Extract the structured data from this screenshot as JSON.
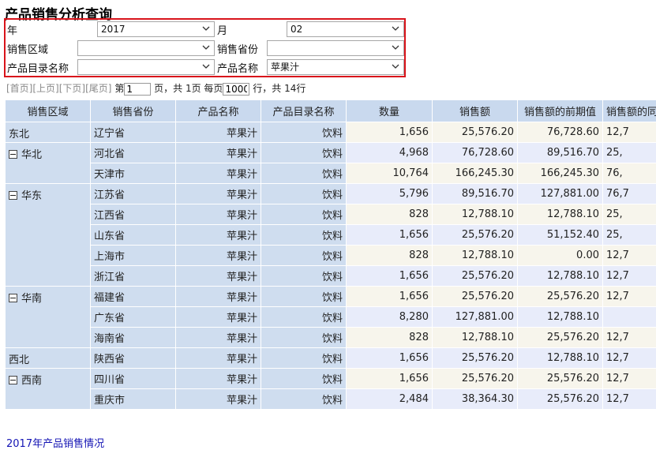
{
  "title": "产品销售分析查询",
  "filters": {
    "year_label": "年",
    "year_value": "2017",
    "month_label": "月",
    "month_value": "02",
    "region_label": "销售区域",
    "region_value": "",
    "province_label": "销售省份",
    "province_value": "",
    "category_label": "产品目录名称",
    "category_value": "",
    "product_label": "产品名称",
    "product_value": "苹果汁"
  },
  "pager": {
    "first": "[首页]",
    "prev": "[上页]",
    "next": "[下页]",
    "last": "[尾页]",
    "page_prefix": "第",
    "page_value": "1",
    "page_suffix": "页，共 1页 每页",
    "per_page_value": "1000",
    "row_suffix": "行，共 14行"
  },
  "table": {
    "headers": [
      "销售区域",
      "销售省份",
      "产品名称",
      "产品目录名称",
      "数量",
      "销售额",
      "销售额的前期值",
      "销售额的同"
    ],
    "groups": [
      {
        "region": "东北",
        "collapsible": false,
        "rows": [
          {
            "province": "辽宁省",
            "product": "苹果汁",
            "category": "饮料",
            "qty": "1,656",
            "sales": "25,576.20",
            "prev": "76,728.60",
            "yoy": "12,7"
          }
        ]
      },
      {
        "region": "华北",
        "collapsible": true,
        "rows": [
          {
            "province": "河北省",
            "product": "苹果汁",
            "category": "饮料",
            "qty": "4,968",
            "sales": "76,728.60",
            "prev": "89,516.70",
            "yoy": "25,"
          },
          {
            "province": "天津市",
            "product": "苹果汁",
            "category": "饮料",
            "qty": "10,764",
            "sales": "166,245.30",
            "prev": "166,245.30",
            "yoy": "76,"
          }
        ]
      },
      {
        "region": "华东",
        "collapsible": true,
        "rows": [
          {
            "province": "江苏省",
            "product": "苹果汁",
            "category": "饮料",
            "qty": "5,796",
            "sales": "89,516.70",
            "prev": "127,881.00",
            "yoy": "76,7"
          },
          {
            "province": "江西省",
            "product": "苹果汁",
            "category": "饮料",
            "qty": "828",
            "sales": "12,788.10",
            "prev": "12,788.10",
            "yoy": "25,"
          },
          {
            "province": "山东省",
            "product": "苹果汁",
            "category": "饮料",
            "qty": "1,656",
            "sales": "25,576.20",
            "prev": "51,152.40",
            "yoy": "25,"
          },
          {
            "province": "上海市",
            "product": "苹果汁",
            "category": "饮料",
            "qty": "828",
            "sales": "12,788.10",
            "prev": "0.00",
            "yoy": "12,7"
          },
          {
            "province": "浙江省",
            "product": "苹果汁",
            "category": "饮料",
            "qty": "1,656",
            "sales": "25,576.20",
            "prev": "12,788.10",
            "yoy": "12,7"
          }
        ]
      },
      {
        "region": "华南",
        "collapsible": true,
        "rows": [
          {
            "province": "福建省",
            "product": "苹果汁",
            "category": "饮料",
            "qty": "1,656",
            "sales": "25,576.20",
            "prev": "25,576.20",
            "yoy": "12,7"
          },
          {
            "province": "广东省",
            "product": "苹果汁",
            "category": "饮料",
            "qty": "8,280",
            "sales": "127,881.00",
            "prev": "12,788.10",
            "yoy": ""
          },
          {
            "province": "海南省",
            "product": "苹果汁",
            "category": "饮料",
            "qty": "828",
            "sales": "12,788.10",
            "prev": "25,576.20",
            "yoy": "12,7"
          }
        ]
      },
      {
        "region": "西北",
        "collapsible": false,
        "rows": [
          {
            "province": "陕西省",
            "product": "苹果汁",
            "category": "饮料",
            "qty": "1,656",
            "sales": "25,576.20",
            "prev": "12,788.10",
            "yoy": "12,7"
          }
        ]
      },
      {
        "region": "西南",
        "collapsible": true,
        "rows": [
          {
            "province": "四川省",
            "product": "苹果汁",
            "category": "饮料",
            "qty": "1,656",
            "sales": "25,576.20",
            "prev": "25,576.20",
            "yoy": "12,7"
          },
          {
            "province": "重庆市",
            "product": "苹果汁",
            "category": "饮料",
            "qty": "2,484",
            "sales": "38,364.30",
            "prev": "25,576.20",
            "yoy": "12,7"
          }
        ]
      }
    ]
  },
  "footer": {
    "link": "2017年产品销售情况"
  }
}
